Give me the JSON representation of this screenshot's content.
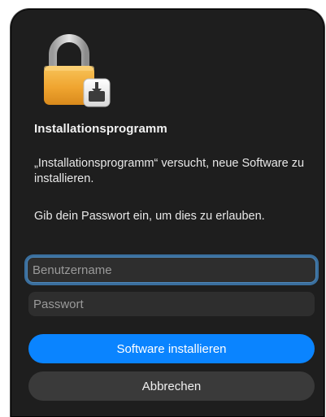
{
  "dialog": {
    "title": "Installationsprogramm",
    "message": "„Installationsprogramm“ versucht, neue Software zu installieren.",
    "instruction": "Gib dein Passwort ein, um dies zu erlauben.",
    "icon": "lock-installer-icon"
  },
  "fields": {
    "username_placeholder": "Benutzername",
    "username_value": "",
    "password_placeholder": "Passwort",
    "password_value": ""
  },
  "buttons": {
    "install_label": "Software installieren",
    "cancel_label": "Abbrechen"
  },
  "colors": {
    "accent": "#0a84ff",
    "dialog_bg": "#1e1e1e",
    "focus_ring": "#3a6f9e"
  }
}
